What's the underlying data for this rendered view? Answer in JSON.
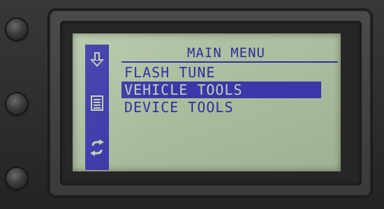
{
  "screen": {
    "title": "MAIN MENU",
    "menu_items": [
      {
        "label": "FLASH TUNE",
        "selected": false
      },
      {
        "label": "VEHICLE TOOLS",
        "selected": true
      },
      {
        "label": "DEVICE TOOLS",
        "selected": false
      }
    ],
    "icon_bar": [
      {
        "icon": "download-arrow-icon"
      },
      {
        "icon": "list-document-icon"
      },
      {
        "icon": "refresh-cycle-icon"
      }
    ]
  },
  "colors": {
    "lcd_background": "#aebf9f",
    "lcd_ink": "#2e2ca0",
    "selection_highlight": "#3a37a8",
    "housing": "#2c2c2c"
  }
}
